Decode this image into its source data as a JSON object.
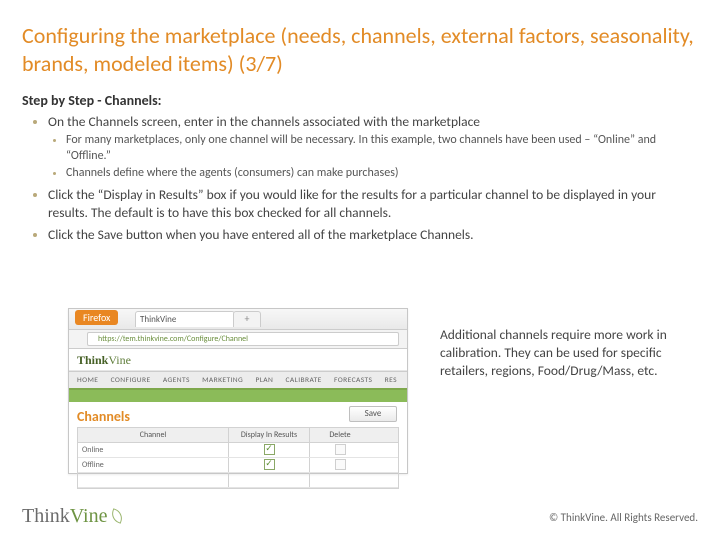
{
  "title": "Configuring the marketplace (needs, channels, external factors, seasonality, brands, modeled items) (3/7)",
  "step_head": "Step by Step - Channels:",
  "bullets": {
    "b1": "On the Channels screen, enter in the channels associated with the marketplace",
    "b1a": "For many marketplaces, only one channel will be necessary.  In this example, two channels have been used – “Online” and “Offline.”",
    "b1b": "Channels define where the agents (consumers) can make purchases)",
    "b2": "Click the “Display in Results” box if you would like for the results for a particular channel to be displayed in your results.  The default is to have this box checked for all channels.",
    "b3": "Click the Save button when you have entered all of the marketplace Channels."
  },
  "shot": {
    "firefox": "Firefox",
    "tab_title": "ThinkVine",
    "tab_plus": "+",
    "url": "https://tem.thinkvine.com/Configure/Channel",
    "brand_t": "Think",
    "brand_v": "Vine",
    "nav": [
      "HOME",
      "CONFIGURE",
      "AGENTS",
      "MARKETING",
      "PLAN",
      "CALIBRATE",
      "FORECASTS",
      "RES"
    ],
    "section": "Channels",
    "save": "Save",
    "cols": {
      "c1": "Channel",
      "c2": "Display In Results",
      "c3": "Delete"
    },
    "rows": [
      {
        "name": "Online",
        "checked": true
      },
      {
        "name": "Offline",
        "checked": true
      }
    ]
  },
  "note": "Additional channels require more work in calibration.  They can be used for specific retailers, regions, Food/Drug/Mass, etc.",
  "footer": {
    "brand_t": "Think",
    "brand_v": "Vine",
    "copy": "© ThinkVine.  All Rights Reserved."
  }
}
